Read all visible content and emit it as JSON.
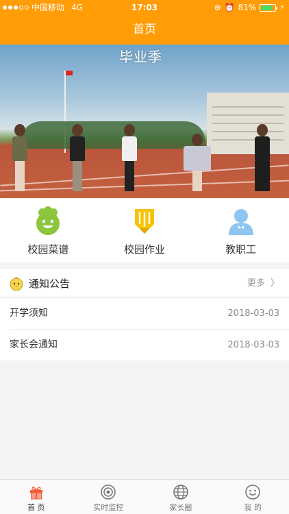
{
  "status": {
    "carrier": "中国移动",
    "network": "4G",
    "time": "17:03",
    "battery": "81%",
    "battery_level": 0.81
  },
  "nav": {
    "title": "首页"
  },
  "banner": {
    "caption": "毕业季"
  },
  "quick": [
    {
      "label": "校园菜谱",
      "icon": "chef-face-icon"
    },
    {
      "label": "校园作业",
      "icon": "pencil-icon"
    },
    {
      "label": "教职工",
      "icon": "staff-person-icon"
    }
  ],
  "notice": {
    "title": "通知公告",
    "more": "更多",
    "items": [
      {
        "title": "开学须知",
        "date": "2018-03-03"
      },
      {
        "title": "家长会通知",
        "date": "2018-03-03"
      }
    ]
  },
  "tabs": [
    {
      "label": "首 页",
      "icon": "gift-icon",
      "active": true
    },
    {
      "label": "实时监控",
      "icon": "camera-icon",
      "active": false
    },
    {
      "label": "家长圈",
      "icon": "globe-icon",
      "active": false
    },
    {
      "label": "我 的",
      "icon": "smiley-icon",
      "active": false
    }
  ],
  "colors": {
    "accent": "#ff9c06",
    "green": "#8cc63f",
    "yellow": "#f7c300",
    "blue": "#8ec5f2",
    "tab_active": "#f25c3a"
  }
}
